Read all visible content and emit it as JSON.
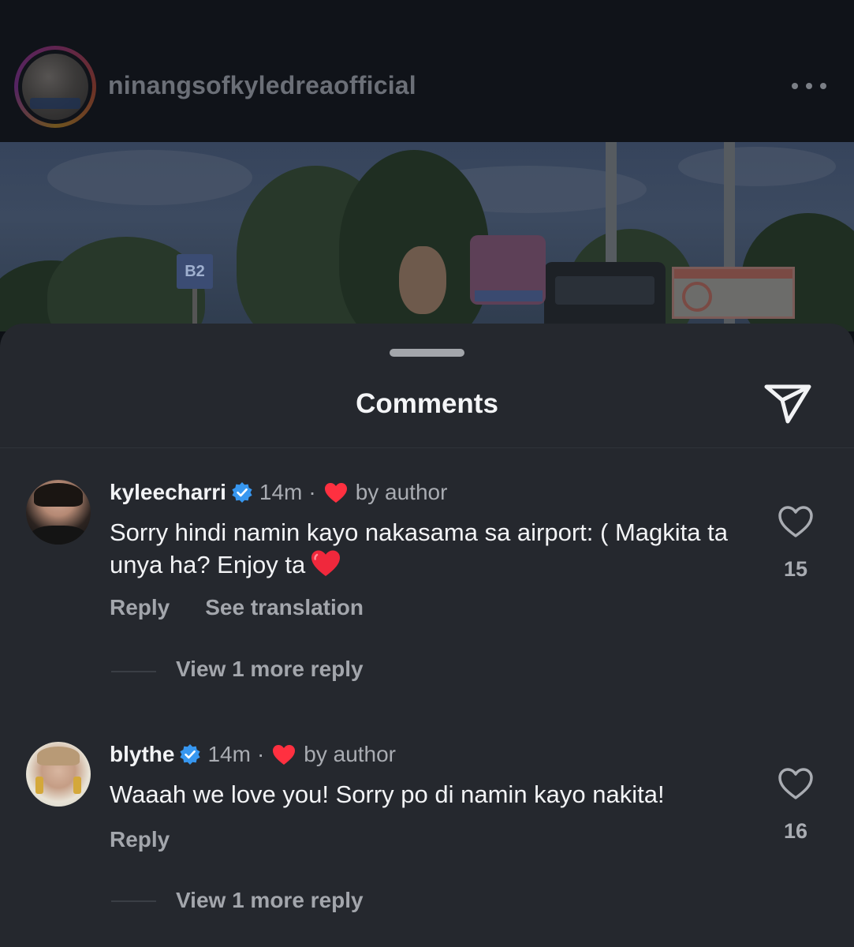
{
  "post": {
    "username": "ninangsofkyledreaofficial",
    "avatar_icon": "account-avatar",
    "more_icon": "more-horizontal-icon"
  },
  "photo": {
    "sign_text": "B2"
  },
  "sheet": {
    "title": "Comments",
    "share_icon": "paper-plane-icon"
  },
  "comments": [
    {
      "username": "kyleecharri",
      "verified": true,
      "time": "14m",
      "separator": "·",
      "liked_by_author_label": "by author",
      "text": "Sorry hindi namin kayo nakasama sa airport: ( Magkita ta unya ha? Enjoy ta",
      "emoji": "❤️",
      "like_count": "15",
      "actions": [
        "Reply",
        "See translation"
      ],
      "view_more": "View 1 more reply"
    },
    {
      "username": "blythe",
      "verified": true,
      "time": "14m",
      "separator": "·",
      "liked_by_author_label": "by author",
      "text": "Waaah we love you! Sorry po di namin kayo nakita!",
      "like_count": "16",
      "actions": [
        "Reply"
      ],
      "view_more": "View 1 more reply"
    }
  ],
  "colors": {
    "sheet_bg": "#25282e",
    "verified_blue": "#3797f0",
    "heart_red": "#ff3040",
    "secondary_text": "#a9acb2"
  }
}
